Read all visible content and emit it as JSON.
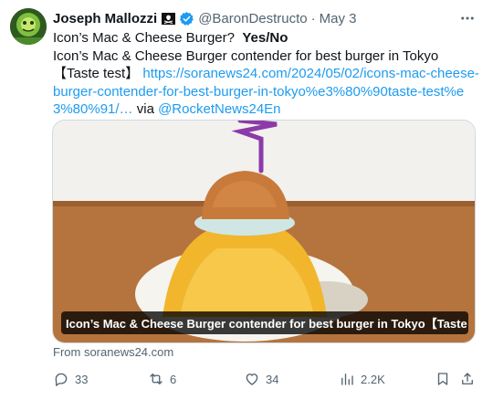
{
  "tweet": {
    "author": {
      "name": "Joseph Mallozzi",
      "handle": "@BaronDestructo",
      "date": "May 3",
      "flag_icon": "pirate-flag-icon",
      "verified_icon": "verified-badge-icon"
    },
    "text": {
      "line1_a": "Icon’s Mac & Cheese Burger?  ",
      "line1_b": "Yes/No",
      "body": "Icon’s Mac & Cheese Burger contender for best burger in Tokyo【Taste test】 ",
      "url": "https://soranews24.com/2024/05/02/icons-mac-cheese-burger-contender-for-best-burger-in-tokyo%e3%80%90taste-test%e3%80%91/…",
      "via": " via ",
      "mention": "@RocketNews24En"
    },
    "card": {
      "caption": "Icon’s Mac & Cheese Burger contender for best burger in Tokyo【Taste tes…",
      "source": "From soranews24.com"
    },
    "actions": {
      "replies": "33",
      "reposts": "6",
      "likes": "34",
      "views": "2.2K"
    }
  },
  "colors": {
    "link": "#1d9bf0",
    "muted": "#536471",
    "verified": "#1d9bf0"
  }
}
